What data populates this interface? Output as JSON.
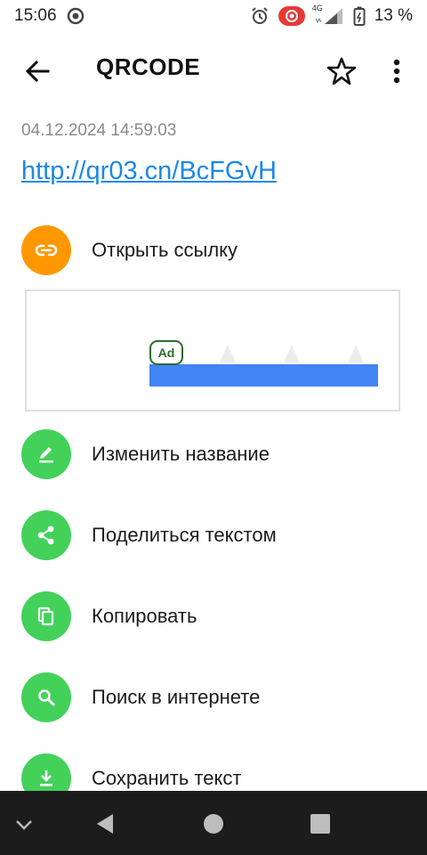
{
  "status_bar": {
    "time": "15:06",
    "network": "4G",
    "battery_percent": "13 %",
    "icons": [
      "target-icon",
      "alarm-icon",
      "screen-record-icon",
      "signal-icon",
      "battery-icon"
    ]
  },
  "app_bar": {
    "title": "QRCODE",
    "icons": [
      "back-arrow-icon",
      "star-icon",
      "more-vert-icon"
    ]
  },
  "scan": {
    "timestamp": "04.12.2024 14:59:03",
    "url": "http://qr03.cn/BcFGvH"
  },
  "actions": [
    {
      "label": "Открыть ссылку",
      "icon": "link-icon",
      "color": "#ff9800"
    },
    {
      "label": "Изменить название",
      "icon": "edit-icon",
      "color": "#43d15a"
    },
    {
      "label": "Поделиться текстом",
      "icon": "share-icon",
      "color": "#43d15a"
    },
    {
      "label": "Копировать",
      "icon": "copy-icon",
      "color": "#43d15a"
    },
    {
      "label": "Поиск в интернете",
      "icon": "search-icon",
      "color": "#43d15a"
    },
    {
      "label": "Сохранить текст",
      "icon": "download-icon",
      "color": "#43d15a"
    }
  ],
  "ad": {
    "badge": "Ad",
    "bar_color": "#4285f4"
  },
  "nav_bar": {
    "icons": [
      "chevron-down-icon",
      "back-triangle-icon",
      "home-circle-icon",
      "recents-square-icon"
    ]
  }
}
